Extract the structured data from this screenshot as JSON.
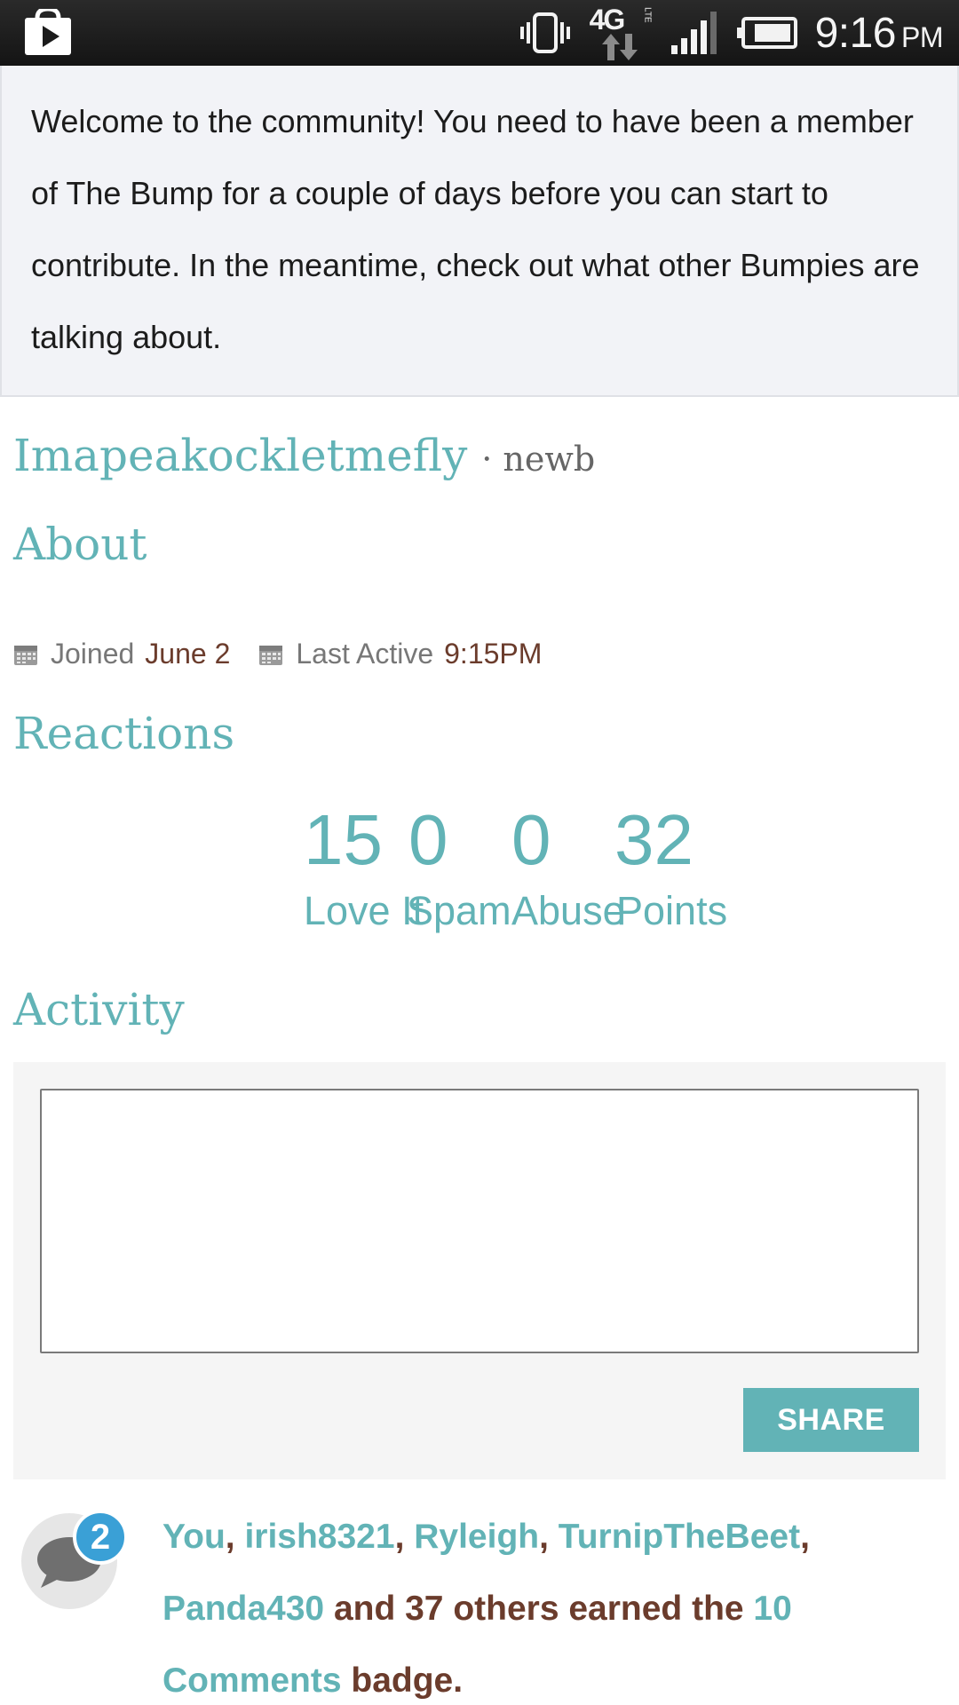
{
  "status_bar": {
    "icons": [
      "play-store-icon",
      "vibrate-icon",
      "4g-lte-icon",
      "signal-icon",
      "battery-icon"
    ],
    "network": "4G",
    "time": "9:16",
    "ampm": "PM"
  },
  "banner": {
    "text": "Welcome to the community! You need to have been a member of The Bump for a couple of days before you can start to contribute. In the meantime, check out what other Bumpies are talking about."
  },
  "profile": {
    "username": "Imapeakockletmefly",
    "rank": "· newb",
    "about_heading": "About",
    "joined_label": "Joined",
    "joined_value": "June 2",
    "last_active_label": "Last Active",
    "last_active_value": "9:15PM"
  },
  "reactions": {
    "heading": "Reactions",
    "items": [
      {
        "value": "15",
        "label": "Love It"
      },
      {
        "value": "0",
        "label": "Spam"
      },
      {
        "value": "0",
        "label": "Abuse"
      },
      {
        "value": "32",
        "label": "Points"
      }
    ]
  },
  "activity": {
    "heading": "Activity",
    "share_label": "SHARE"
  },
  "notification": {
    "count": "2",
    "users": [
      "You",
      "irish8321",
      "Ryleigh",
      "TurnipTheBeet",
      "Panda430"
    ],
    "mid_text": " and 37 others earned the ",
    "badge_name": "10 Comments",
    "end_text": " badge."
  },
  "colors": {
    "accent": "#62b3b6",
    "brown": "#6b3c2c",
    "banner_bg": "#f2f3f7",
    "badge_blue": "#3aa0d6"
  }
}
